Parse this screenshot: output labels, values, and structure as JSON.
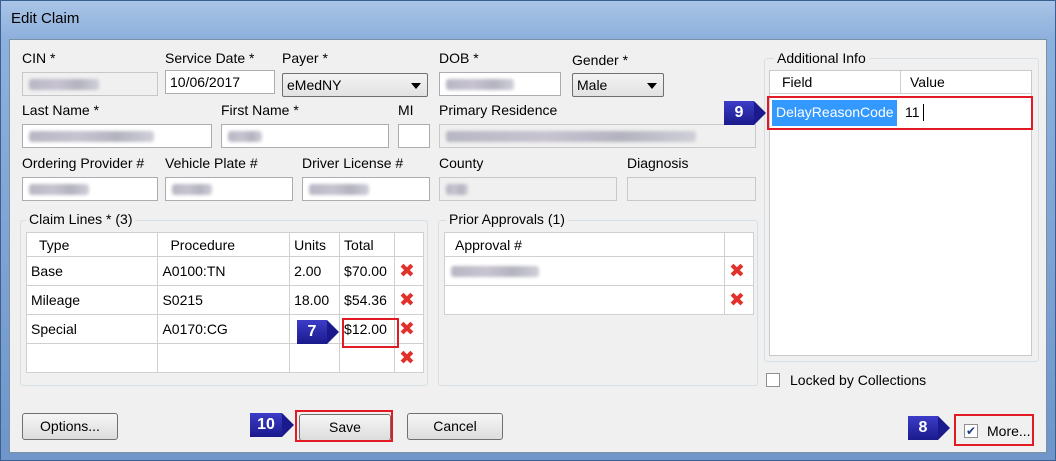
{
  "window": {
    "title": "Edit Claim"
  },
  "fields": {
    "cin_label": "CIN *",
    "service_date_label": "Service Date *",
    "service_date_value": "10/06/2017",
    "payer_label": "Payer *",
    "payer_value": "eMedNY",
    "dob_label": "DOB *",
    "gender_label": "Gender *",
    "gender_value": "Male",
    "last_name_label": "Last Name *",
    "first_name_label": "First Name *",
    "mi_label": "MI",
    "primary_residence_label": "Primary Residence",
    "ordering_provider_label": "Ordering Provider #",
    "vehicle_plate_label": "Vehicle Plate #",
    "driver_license_label": "Driver License #",
    "county_label": "County",
    "diagnosis_label": "Diagnosis"
  },
  "claim_lines": {
    "title": "Claim Lines * (3)",
    "columns": [
      "Type",
      "Procedure",
      "Units",
      "Total"
    ],
    "rows": [
      {
        "type": "Base",
        "procedure": "A0100:TN",
        "units": "2.00",
        "total": "$70.00"
      },
      {
        "type": "Mileage",
        "procedure": "S0215",
        "units": "18.00",
        "total": "$54.36"
      },
      {
        "type": "Special",
        "procedure": "A0170:CG",
        "units": "",
        "total": "$12.00"
      }
    ]
  },
  "prior_approvals": {
    "title": "Prior Approvals (1)",
    "column": "Approval #"
  },
  "additional_info": {
    "title": "Additional Info",
    "columns": [
      "Field",
      "Value"
    ],
    "field": "DelayReasonCode",
    "value": "11"
  },
  "locked_by_collections": {
    "label": "Locked by Collections",
    "checked": false
  },
  "buttons": {
    "options": "Options...",
    "save": "Save",
    "cancel": "Cancel",
    "more": "More..."
  },
  "more_checked": true,
  "callouts": {
    "c7": "7",
    "c8": "8",
    "c9": "9",
    "c10": "10"
  },
  "icons": {
    "delete": "delete-x-icon",
    "check": "checkmark-icon"
  }
}
